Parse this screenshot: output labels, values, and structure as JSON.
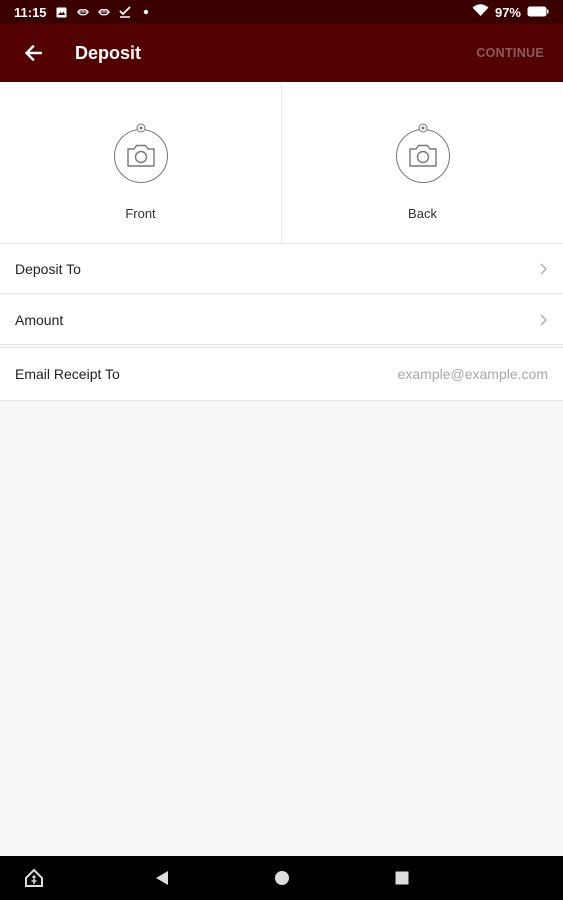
{
  "status_bar": {
    "time": "11:15",
    "battery": "97%"
  },
  "app_bar": {
    "title": "Deposit",
    "continue_label": "CONTINUE"
  },
  "capture": {
    "front_label": "Front",
    "back_label": "Back"
  },
  "form": {
    "deposit_to_label": "Deposit To",
    "amount_label": "Amount",
    "email_label": "Email Receipt To",
    "email_placeholder": "example@example.com",
    "email_value": ""
  },
  "colors": {
    "status_bar": "#3a0000",
    "app_bar": "#520000",
    "continue_disabled": "#8a5c5c"
  }
}
